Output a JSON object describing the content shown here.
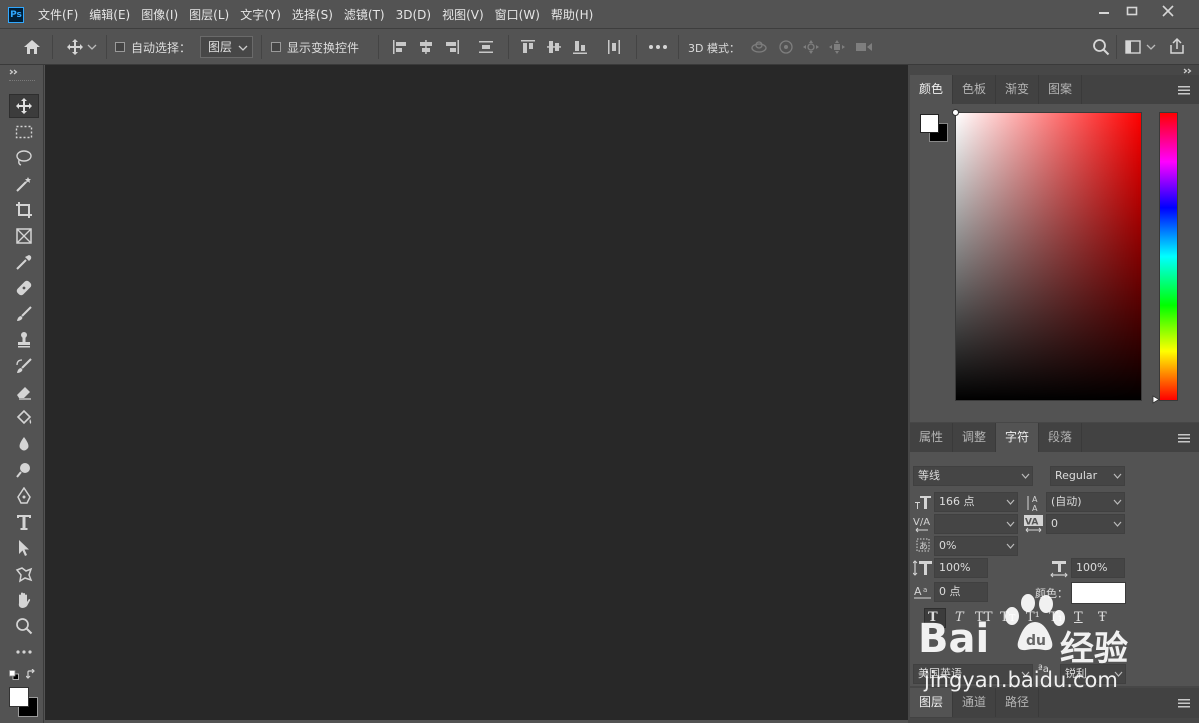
{
  "app": {
    "logo": "Ps"
  },
  "menu": [
    "文件(F)",
    "编辑(E)",
    "图像(I)",
    "图层(L)",
    "文字(Y)",
    "选择(S)",
    "滤镜(T)",
    "3D(D)",
    "视图(V)",
    "窗口(W)",
    "帮助(H)"
  ],
  "options": {
    "auto_select_label": "自动选择：",
    "auto_select_value": "图层",
    "show_transform_label": "显示变换控件",
    "mode_3d_label": "3D 模式："
  },
  "color_panel": {
    "tabs": [
      "颜色",
      "色板",
      "渐变",
      "图案"
    ],
    "active_tab": "颜色",
    "foreground": "#ffffff",
    "background": "#000000",
    "hue": "#ff0000"
  },
  "character_panel": {
    "tabs": [
      "属性",
      "调整",
      "字符",
      "段落"
    ],
    "active_tab": "字符",
    "font_family": "等线",
    "font_style": "Regular",
    "font_size": "166 点",
    "leading": "(自动)",
    "kerning": "",
    "tracking": "0",
    "tsume": "0%",
    "vertical_scale": "100%",
    "horizontal_scale": "100%",
    "baseline_shift": "0 点",
    "color_label": "颜色：",
    "color": "#ffffff",
    "style_buttons": [
      "T",
      "T",
      "TT",
      "Tт",
      "T¹",
      "T₁",
      "T",
      "Ŧ"
    ],
    "language": "美国英语",
    "antialias_icon": "ªa",
    "antialias": "锐利"
  },
  "layers_panel": {
    "tabs": [
      "图层",
      "通道",
      "路径"
    ],
    "active_tab": "图层"
  },
  "watermark": {
    "brand_left": "Bai",
    "brand_right": "经验",
    "url": "jingyan.baidu.com"
  }
}
